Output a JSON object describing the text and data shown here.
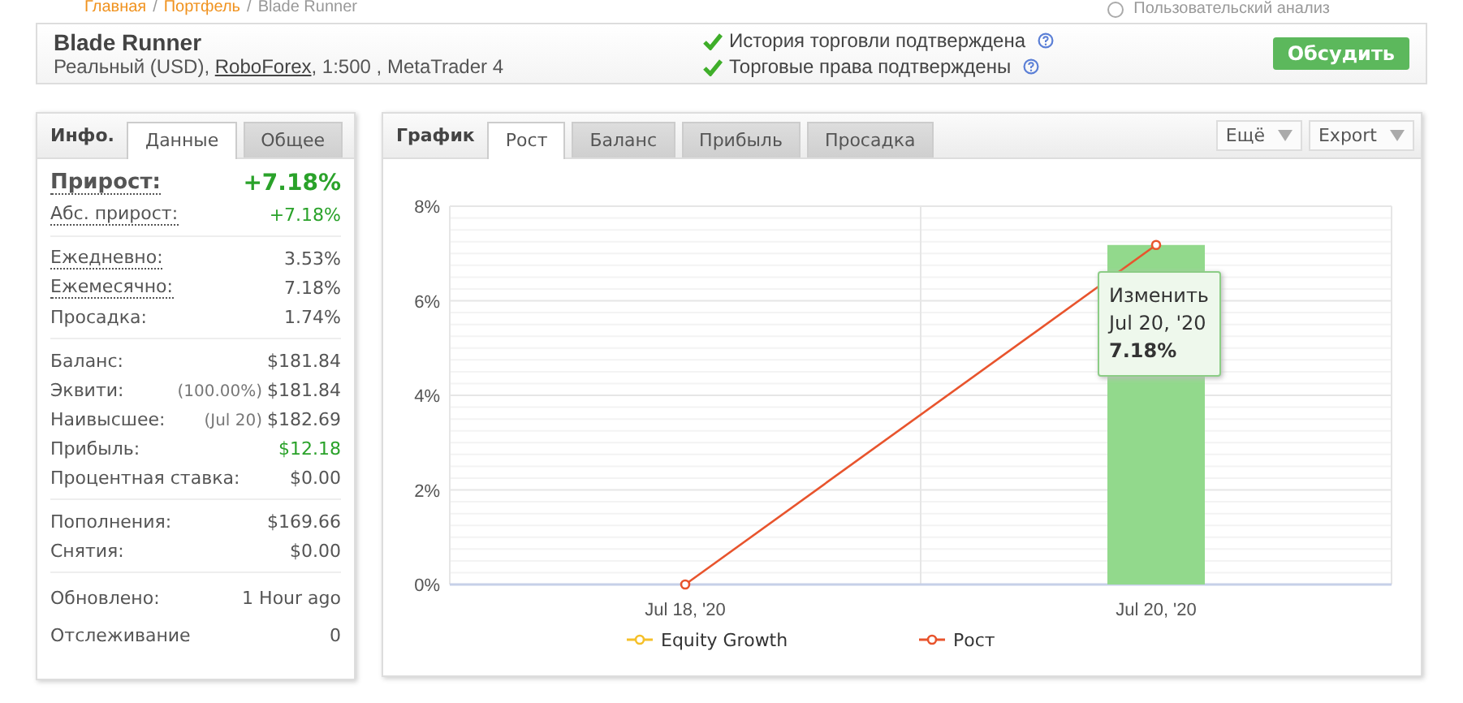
{
  "breadcrumbs": [
    "Главная",
    "Портфель",
    "Blade Runner"
  ],
  "breadcrumb_separator": "/",
  "custom_analysis": {
    "label": "Пользовательский анализ",
    "selected": false
  },
  "header": {
    "title": "Blade Runner",
    "subtitle_before": "Реальный (USD), ",
    "broker_link": "RoboForex",
    "subtitle_after": ", 1:500 , MetaTrader 4",
    "verifications": [
      {
        "label": "История торговли подтверждена",
        "verified": true
      },
      {
        "label": "Торговые права подтверждены",
        "verified": true
      }
    ],
    "discuss_button": "Обсудить"
  },
  "info_panel": {
    "title": "Инфо.",
    "tabs": [
      {
        "label": "Данные",
        "selected": true
      },
      {
        "label": "Общее",
        "selected": false
      }
    ],
    "sections": [
      [
        {
          "label": "Прирост:",
          "value": "+7.18%",
          "kind": "main",
          "dotted": true,
          "positive": true
        },
        {
          "label": "Абс. прирост:",
          "value": "+7.18%",
          "kind": "normal",
          "dotted": true,
          "positive": true
        }
      ],
      [
        {
          "label": "Ежедневно:",
          "value": "3.53%",
          "kind": "normal",
          "dotted": true,
          "positive": false
        },
        {
          "label": "Ежемесячно:",
          "value": "7.18%",
          "kind": "normal",
          "dotted": true,
          "positive": false
        },
        {
          "label": "Просадка:",
          "value": "1.74%",
          "kind": "normal",
          "dotted": false,
          "positive": false
        }
      ],
      [
        {
          "label": "Баланс:",
          "value": "$181.84",
          "kind": "normal",
          "dotted": false,
          "positive": false
        },
        {
          "label": "Эквити:",
          "note": "(100.00%)",
          "value": "$181.84",
          "kind": "normal",
          "dotted": false,
          "positive": false
        },
        {
          "label": "Наивысшее:",
          "note": "(Jul 20)",
          "value": "$182.69",
          "kind": "normal",
          "dotted": false,
          "positive": false
        },
        {
          "label": "Прибыль:",
          "value": "$12.18",
          "kind": "normal",
          "dotted": false,
          "positive": true
        },
        {
          "label": "Процентная ставка:",
          "value": "$0.00",
          "kind": "normal",
          "dotted": false,
          "positive": false
        }
      ],
      [
        {
          "label": "Пополнения:",
          "value": "$169.66",
          "kind": "normal",
          "dotted": false,
          "positive": false
        },
        {
          "label": "Снятия:",
          "value": "$0.00",
          "kind": "normal",
          "dotted": false,
          "positive": false
        }
      ],
      [
        {
          "label": "Обновлено:",
          "value": "1 Hour ago",
          "kind": "tall",
          "dotted": false,
          "positive": false
        },
        {
          "label": "Отслеживание",
          "value": "0",
          "kind": "tall",
          "dotted": false,
          "positive": false
        }
      ]
    ]
  },
  "chart_panel": {
    "title": "График",
    "tabs": [
      {
        "label": "Рост",
        "selected": true
      },
      {
        "label": "Баланс",
        "selected": false
      },
      {
        "label": "Прибыль",
        "selected": false
      },
      {
        "label": "Просадка",
        "selected": false
      }
    ],
    "menus": [
      "Ещё",
      "Export"
    ],
    "tooltip": {
      "title": "Изменить",
      "date": "Jul 20, '20",
      "value": "7.18%"
    },
    "chart_data": {
      "type": "line",
      "grid": true,
      "categories": [
        "Jul 18, '20",
        "Jul 20, '20"
      ],
      "ylim": [
        0,
        8
      ],
      "yticks": [
        {
          "value": 0,
          "label": "0%"
        },
        {
          "value": 2,
          "label": "2%"
        },
        {
          "value": 4,
          "label": "4%"
        },
        {
          "value": 6,
          "label": "6%"
        },
        {
          "value": 8,
          "label": "8%"
        }
      ],
      "series": [
        {
          "type": "bar",
          "color": "#92d98c",
          "values": [
            null,
            7.18
          ]
        },
        {
          "name": "Equity Growth",
          "marker": "circle",
          "color": "#f5c02a",
          "values": [
            null,
            null
          ]
        },
        {
          "name": "Рост",
          "marker": "circle",
          "color": "#e8542d",
          "values": [
            0,
            7.18
          ]
        }
      ]
    }
  }
}
